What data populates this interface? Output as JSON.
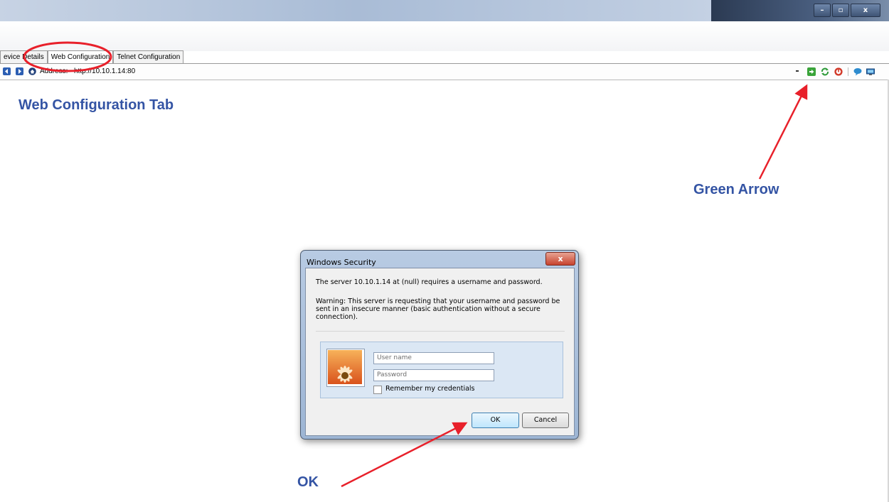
{
  "window": {
    "controls": {
      "minimize": "–",
      "maximize": "▫",
      "close": "x"
    }
  },
  "tabs": [
    {
      "label": "evice Details"
    },
    {
      "label": "Web Configuration",
      "active": true
    },
    {
      "label": "Telnet Configuration"
    }
  ],
  "navbar": {
    "address_label": "Address:",
    "address_value": "http://10.10.1.14:80",
    "left_icons": [
      "back-arrow-icon",
      "forward-arrow-icon",
      "home-icon"
    ],
    "right_icons": [
      "dropdown-icon",
      "green-arrow-go-icon",
      "refresh-icon",
      "stop-icon",
      "chat-icon",
      "screen-icon"
    ]
  },
  "annotations": {
    "web_config_tab": "Web Configuration Tab",
    "green_arrow": "Green Arrow",
    "ok": "OK"
  },
  "dialog": {
    "title": "Windows Security",
    "close_label": "x",
    "message": "The server 10.10.1.14 at (null) requires a username and password.",
    "warning_line1": "Warning: This server is requesting that your username and password be",
    "warning_line2": "sent in an insecure manner (basic authentication without a secure",
    "warning_line3": "connection).",
    "username_placeholder": "User name",
    "password_placeholder": "Password",
    "remember_label": "Remember my credentials",
    "ok_label": "OK",
    "cancel_label": "Cancel"
  },
  "colors": {
    "annotation_text": "#3454a4",
    "annotation_arrow": "#e8202a",
    "dialog_frame": "#a9bfdc",
    "ok_button": "#bee6fd"
  }
}
